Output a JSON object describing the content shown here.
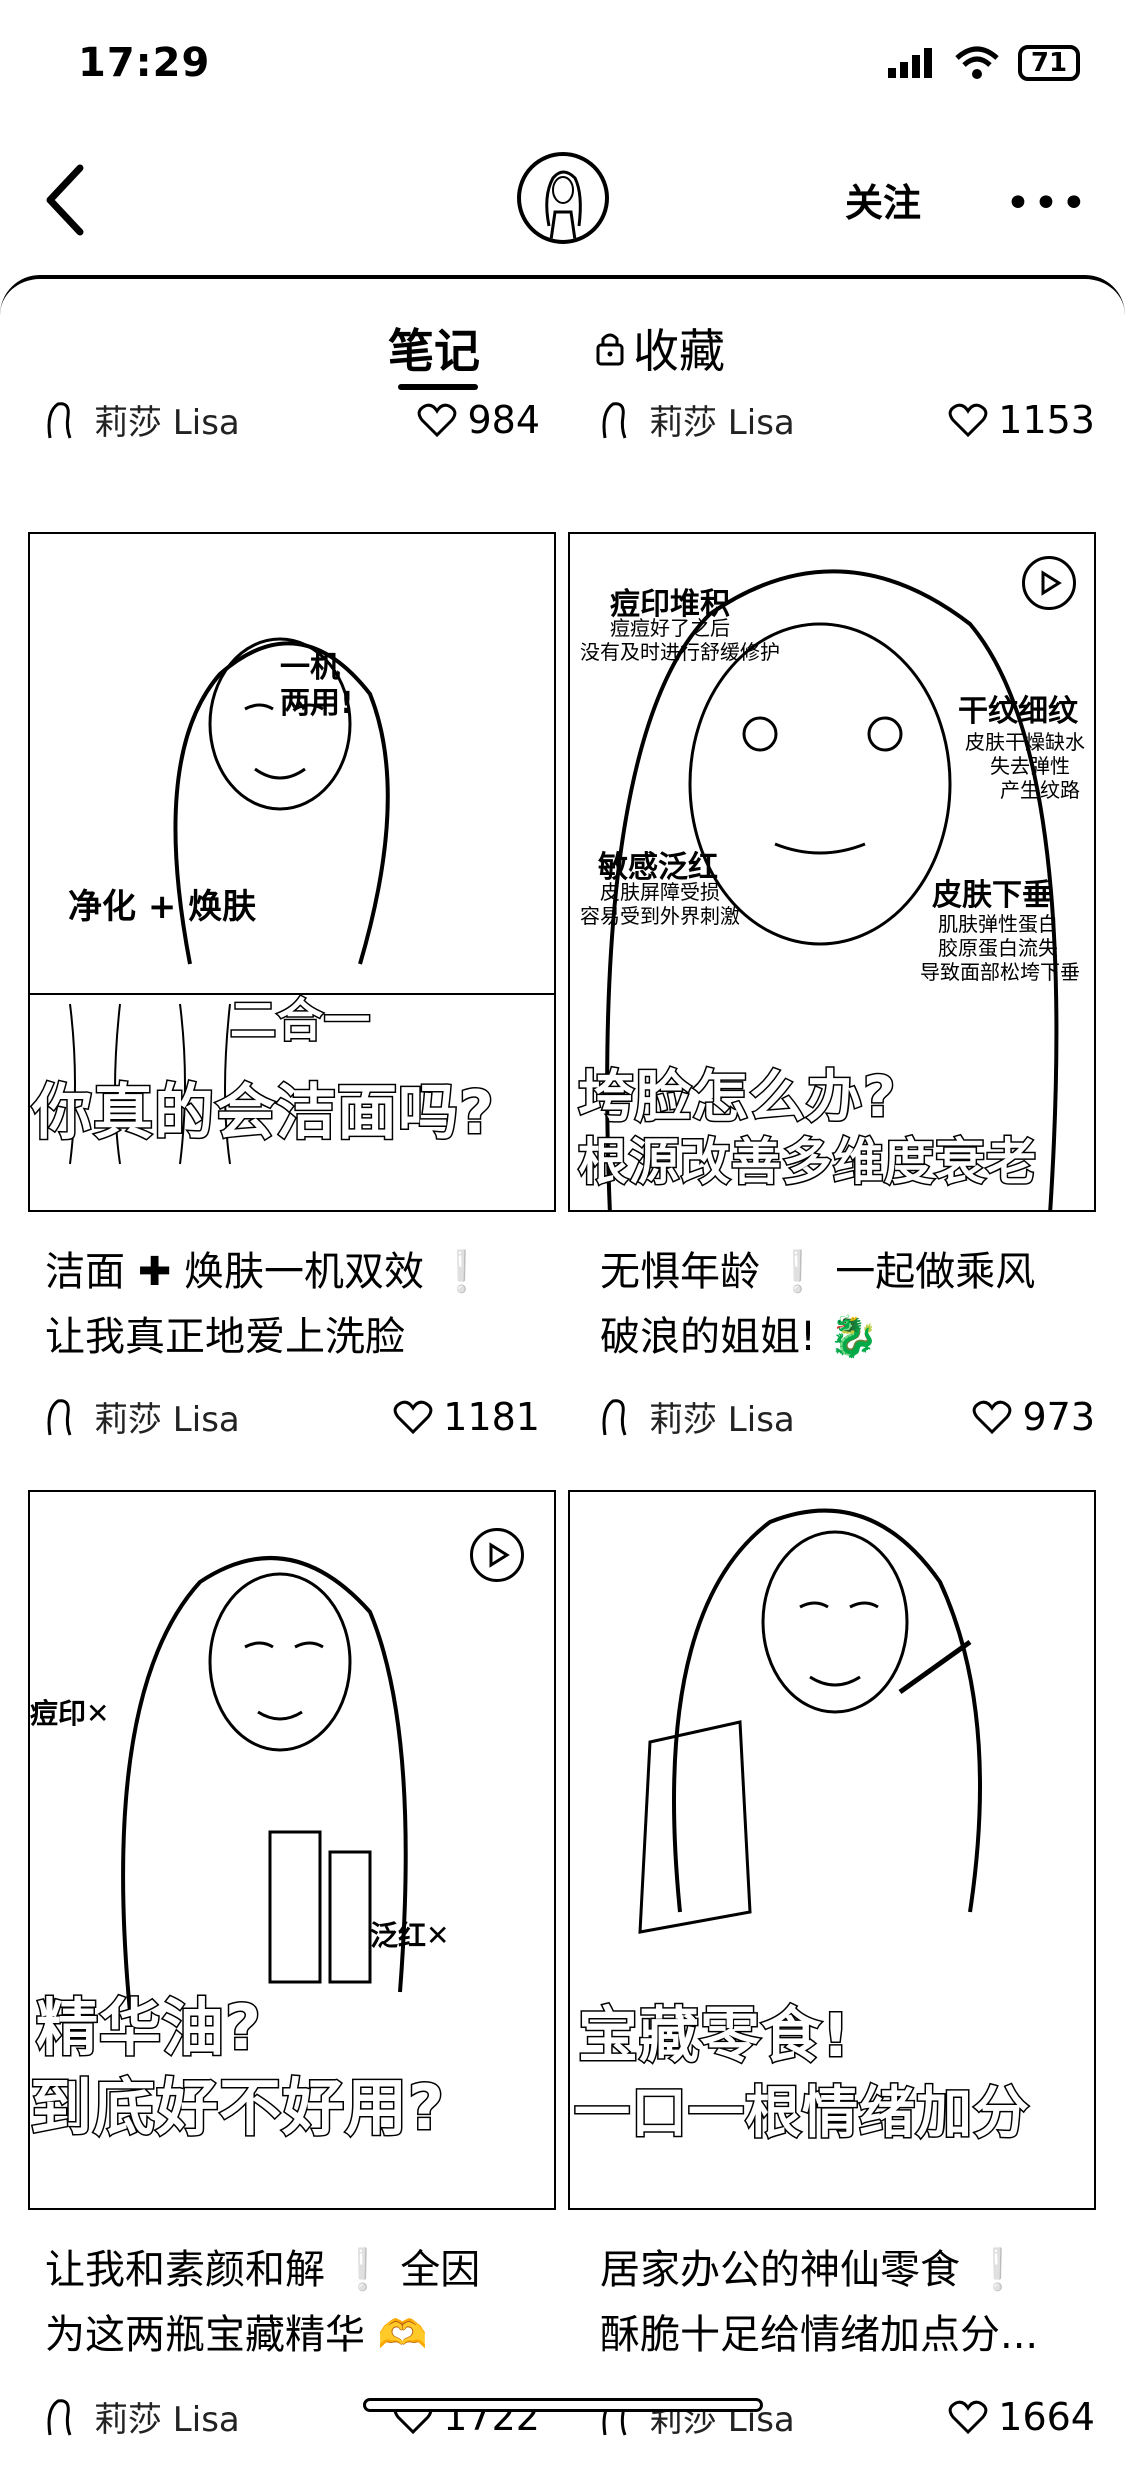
{
  "status_bar": {
    "time": "17:29",
    "battery": "71"
  },
  "header": {
    "follow_label": "关注",
    "more_label": "•••"
  },
  "tabs": {
    "notes": "笔记",
    "favorites": "收藏"
  },
  "author": "莉莎 Lisa",
  "top_row": [
    {
      "likes": "984"
    },
    {
      "likes": "1153"
    }
  ],
  "notes": [
    {
      "image": {
        "headline": "你真的会洁面吗?",
        "stickers": [
          "净化 + 焕肤",
          "二合一",
          "一机",
          "两用!"
        ]
      },
      "title": [
        "洁面 ✚ 焕肤一机双效 ❕",
        "让我真正地爱上洗脸"
      ],
      "likes": "1181"
    },
    {
      "image": {
        "headline": "垮脸怎么办?",
        "headline2": "根源改善多维度衰老",
        "stickers": [
          "痘印堆积",
          "干纹细纹",
          "敏感泛红",
          "皮肤下垂"
        ],
        "subs": [
          "痘痘好了之后",
          "没有及时进行舒缓修护",
          "皮肤干燥缺水",
          "失去弹性",
          "产生纹路",
          "皮肤屏障受损",
          "容易受到外界刺激",
          "肌肤弹性蛋白",
          "胶原蛋白流失",
          "导致面部松垮下垂"
        ]
      },
      "title": [
        "无惧年龄 ❕ 一起做乘风",
        "破浪的姐姐! 🐉"
      ],
      "likes": "973"
    },
    {
      "image": {
        "headline": "精华油?",
        "headline2": "到底好不好用?",
        "stickers": [
          "痘印✕",
          "泛红✕"
        ]
      },
      "title": [
        "让我和素颜和解 ❕ 全因",
        "为这两瓶宝藏精华 🫶"
      ],
      "likes": "1722"
    },
    {
      "image": {
        "headline": "宝藏零食!",
        "headline2": "一口一根情绪加分"
      },
      "title": [
        "居家办公的神仙零食 ❕",
        "酥脆十足给情绪加点分..."
      ],
      "likes": "1664"
    }
  ]
}
